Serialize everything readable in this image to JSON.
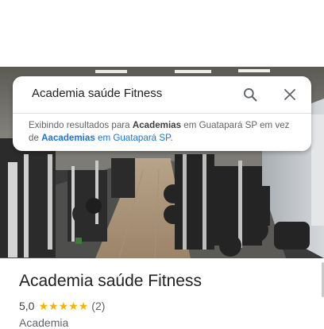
{
  "search": {
    "query": "Academia saúde Fitness"
  },
  "notice": {
    "prefix": "Exibindo resultados para ",
    "corrected_term": "Academias",
    "middle": " em Guatapará SP em vez de ",
    "original_term": "Aacademias",
    "original_suffix": " em Guatapará SP",
    "end": "."
  },
  "place": {
    "name": "Academia saúde Fitness",
    "rating": "5,0",
    "rating_value": 5.0,
    "stars_max": 5,
    "review_count": "(2)",
    "category": "Academia"
  },
  "icons": {
    "search": "search-icon",
    "close": "close-icon",
    "star": "star-icon"
  },
  "colors": {
    "star": "#f4b400",
    "link": "#1a73e8",
    "text": "#202124",
    "muted": "#5f6368"
  }
}
